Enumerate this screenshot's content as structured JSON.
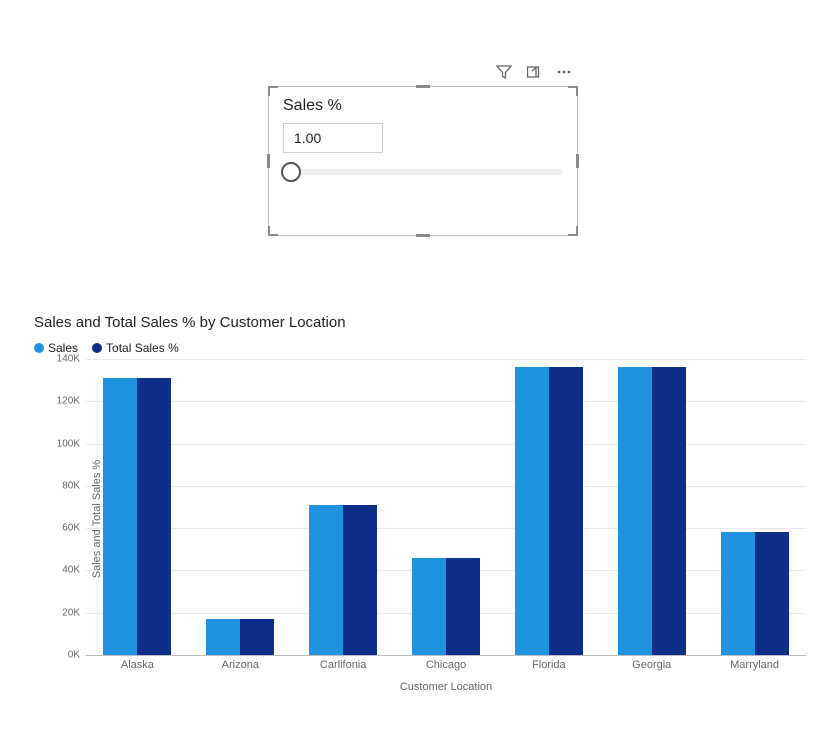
{
  "slicer": {
    "title": "Sales %",
    "value": "1.00"
  },
  "chart_data": {
    "type": "bar",
    "title": "Sales and Total Sales % by Customer Location",
    "xlabel": "Customer Location",
    "ylabel": "Sales and Total Sales %",
    "ylim": [
      0,
      140000
    ],
    "yticks": [
      0,
      20000,
      40000,
      60000,
      80000,
      100000,
      120000,
      140000
    ],
    "ytick_labels": [
      "0K",
      "20K",
      "40K",
      "60K",
      "80K",
      "100K",
      "120K",
      "140K"
    ],
    "categories": [
      "Alaska",
      "Arizona",
      "Carlifonia",
      "Chicago",
      "Florida",
      "Georgia",
      "Marryland"
    ],
    "series": [
      {
        "name": "Sales",
        "color": "#1f93e0",
        "values": [
          131000,
          17000,
          71000,
          46000,
          136000,
          136000,
          58000
        ]
      },
      {
        "name": "Total Sales %",
        "color": "#0f2e8a",
        "values": [
          131000,
          17000,
          71000,
          46000,
          136000,
          136000,
          58000
        ]
      }
    ]
  }
}
